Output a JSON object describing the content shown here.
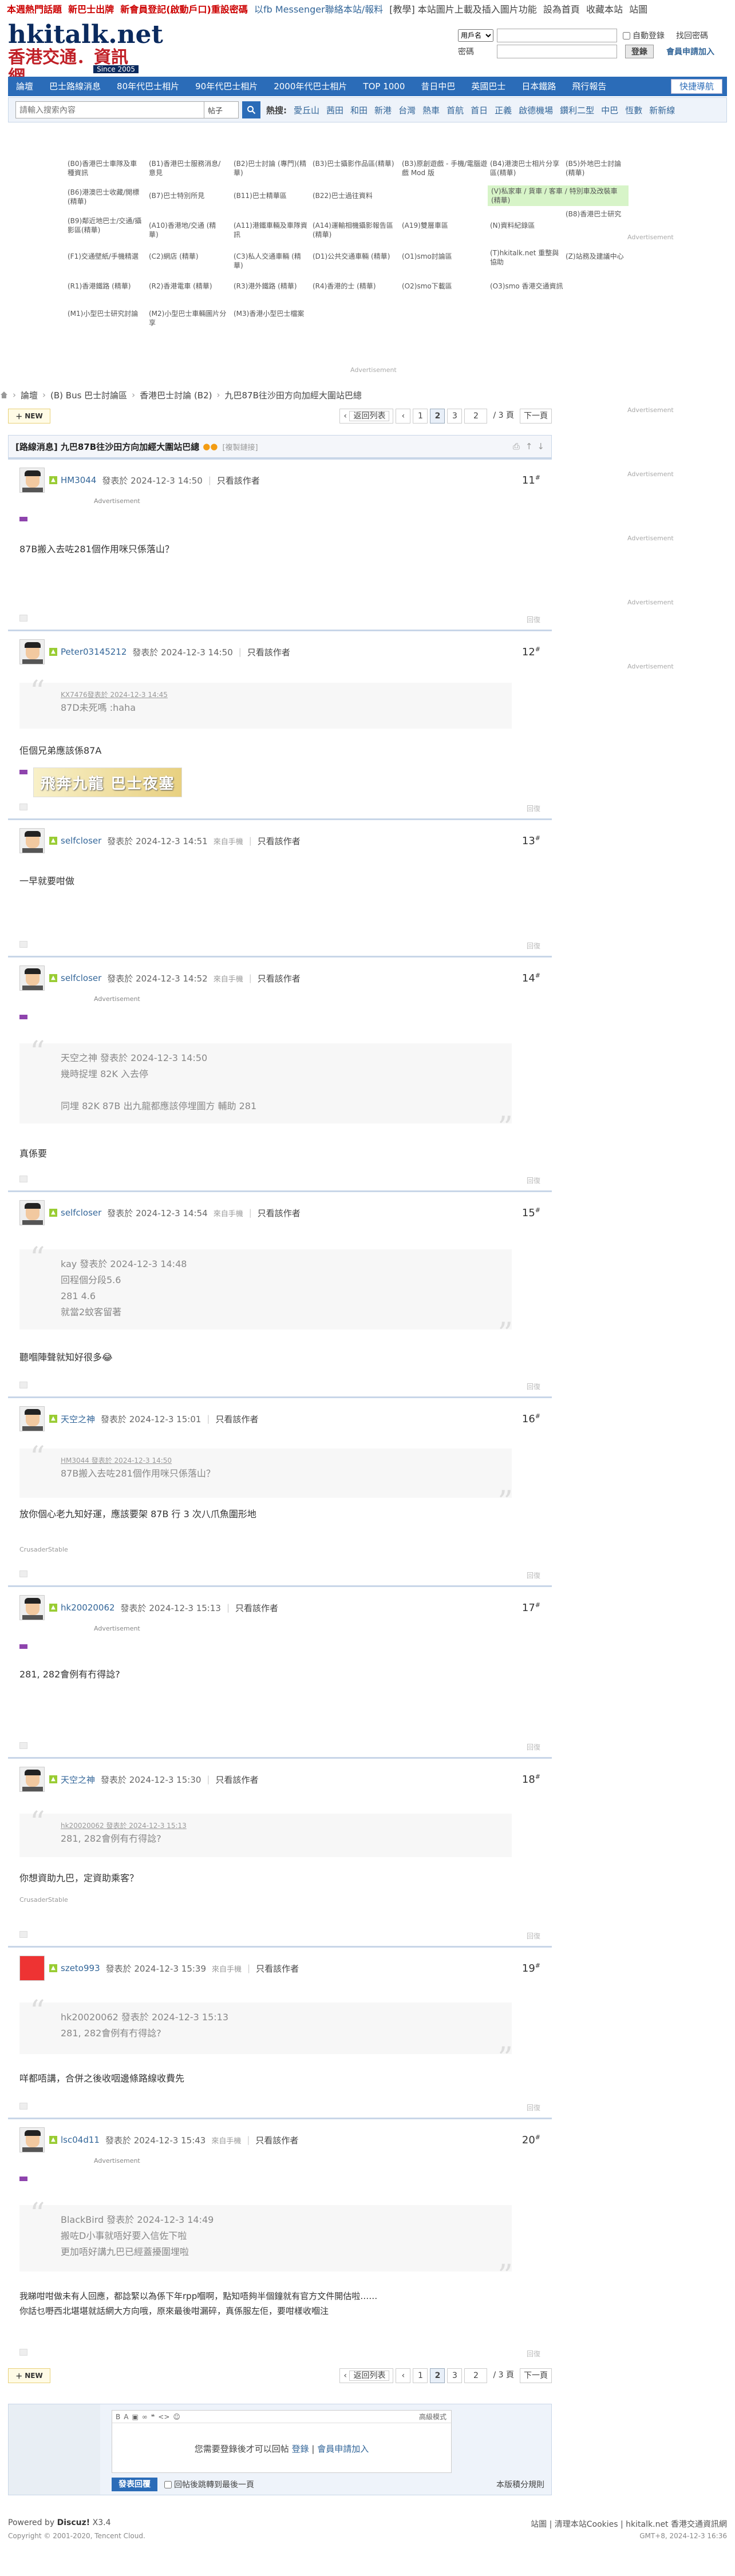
{
  "topnotice": [
    {
      "text": "本週熱門話題",
      "color": "#c00"
    },
    {
      "text": "新巴士出牌",
      "color": "#c00"
    },
    {
      "text": "新會員登記(啟動戶口)重設密碼",
      "color": "#c00"
    },
    {
      "text": "以fb Messenger聯絡本站/報料",
      "color": "#369"
    },
    {
      "text": "[教學] 本站圖片上載及插入圖片功能",
      "color": "#333"
    },
    {
      "text": "設為首頁",
      "color": "#333"
    },
    {
      "text": "收藏本站",
      "color": "#333"
    },
    {
      "text": "站圖",
      "color": "#333"
    }
  ],
  "logo": {
    "line1": "hkitalk.net",
    "line2": "香港交通．資訊網",
    "since": "Since 2005"
  },
  "login": {
    "username_select": "用戶名",
    "password_label": "密碼",
    "auto_login": "自動登錄",
    "find_password": "找回密碼",
    "login_button": "登錄",
    "register": "會員申請加入"
  },
  "nav": {
    "items": [
      "論壇",
      "巴士路線消息",
      "80年代巴士相片",
      "90年代巴士相片",
      "2000年代巴士相片",
      "TOP 1000",
      "昔日中巴",
      "英國巴士",
      "日本鐵路",
      "飛行報告"
    ],
    "quick": "快捷導航"
  },
  "search": {
    "placeholder": "請輸入搜索內容",
    "scope": "帖子",
    "hot_label": "熱搜:",
    "hot": [
      "愛丘山",
      "茜田",
      "和田",
      "新港",
      "台灣",
      "熱車",
      "首航",
      "首日",
      "正義",
      "啟德機場",
      "鑽利二型",
      "中巴",
      "恆數",
      "新新線"
    ]
  },
  "forums": [
    "(B0)香港巴士車隊及車種資訊",
    "(B1)香港巴士服務消息/意見",
    "(B2)巴士討論 (專門)(精華)",
    "(B3)巴士攝影作品區(精華)",
    "(B3)原創遊戲 - 手機/電腦遊戲 Mod 版",
    "(B4)港澳巴士相片分享區(精華)",
    "(B5)外地巴士討論 (精華)",
    "(B6)港澳巴士收藏/開標(精華)",
    "(B7)巴士特別所見",
    "(B11)巴士精華區",
    "(B22)巴士過往資料",
    "(V)私家車 / 貨車 / 客車 / 特別車及改裝車 (精華)",
    "(B8)香港巴士研究",
    "(B9)鄰近地巴士/交通/攝影區(精華)",
    "(A10)香港地/交通 (精華)",
    "(A11)港鐵車輛及車隊資訊",
    "(A14)運輸相機攝影報告區(精華)",
    "(A19)雙層車區",
    "(N)資料紀錄區",
    "(F1)交通壁紙/手機精選",
    "(C2)網店 (精華)",
    "(C3)私人交通車輛 (精華)",
    "(D1)公共交通車輛 (精華)",
    "(O1)smo討論區",
    "(T)hkitalk.net 重整與 協助",
    "(Z)站務及建議中心",
    "(R1)香港鐵路 (精華)",
    "(R2)香港電車 (精華)",
    "(R3)港外鐵路 (精華)",
    "(R4)香港的士 (精華)",
    "(O2)smo下載區",
    "(O3)smo 香港交通資訊",
    "(M1)小型巴士研究討論",
    "(M2)小型巴士車輛圖片分享",
    "(M3)香港小型巴士檔案"
  ],
  "ads": {
    "label": "Advertisement"
  },
  "crumb": [
    "論壇",
    "(B) Bus 巴士討論區",
    "香港巴士討論 (B2)",
    "九巴87B往沙田方向加經大圍站巴總"
  ],
  "pager": {
    "new_label": "NEW",
    "back": "返回列表",
    "pages": [
      "1",
      "2",
      "3"
    ],
    "current": "2",
    "input_val": "2",
    "total": "/ 3 頁",
    "next": "下一頁"
  },
  "thread": {
    "title": "[路線消息] 九巴87B往沙田方向加經大圍站巴總",
    "tag": "[複製鏈接]"
  },
  "posts": [
    {
      "user": "HM3044",
      "time": "發表於 2024-12-3 14:50",
      "only": "只看該作者",
      "floor": "11",
      "body": "87B搬入去咗281個作用咪只係落山？"
    },
    {
      "user": "Peter03145212",
      "time": "發表於 2024-12-3 14:50",
      "only": "只看該作者",
      "floor": "12",
      "quote_small": "KX7476發表於 2024-12-3 14:45",
      "quote": "87D未死嗎 :haha",
      "body": "佢個兄弟應該係87A",
      "sig": "飛奔九龍 巴士夜塞"
    },
    {
      "user": "selfcloser",
      "time": "發表於 2024-12-3 14:51",
      "mobile": "來自手機",
      "only": "只看該作者",
      "floor": "13",
      "body": "一早就要咁做"
    },
    {
      "user": "selfcloser",
      "time": "發表於 2024-12-3 14:52",
      "mobile": "來自手機",
      "only": "只看該作者",
      "floor": "14",
      "quote_lines": [
        "天空之神 發表於 2024-12-3 14:50",
        "幾時捉埋 82K 入去停",
        "",
        "同埋 82K 87B 出九龍都應該停埋圖方 輔助 281"
      ],
      "body": "真係要"
    },
    {
      "user": "selfcloser",
      "time": "發表於 2024-12-3 14:54",
      "mobile": "來自手機",
      "only": "只看該作者",
      "floor": "15",
      "quote_lines": [
        "kay 發表於 2024-12-3 14:48",
        "回程個分段5.6",
        "281 4.6",
        "就當2蚊客留著"
      ],
      "body": "聽嗰陣聲就知好很多😂"
    },
    {
      "user": "天空之神",
      "time": "發表於 2024-12-3 15:01",
      "only": "只看該作者",
      "floor": "16",
      "quote_small": "HM3044 發表於 2024-12-3 14:50",
      "quote": "87B搬入去咗281個作用咪只係落山？",
      "body": "放你個心老九知好運，應該要架 87B 行 3 次八爪魚圍形地",
      "sig": "CrusaderStable"
    },
    {
      "user": "hk20020062",
      "time": "發表於 2024-12-3 15:13",
      "only": "只看該作者",
      "floor": "17",
      "body": "281, 282會例有冇得諗?"
    },
    {
      "user": "天空之神",
      "time": "發表於 2024-12-3 15:30",
      "only": "只看該作者",
      "floor": "18",
      "quote_small": "hk20020062 發表於 2024-12-3 15:13",
      "quote": "281, 282會例有冇得諗?",
      "body": "你想資助九巴，定資助乘客？",
      "sig": "CrusaderStable"
    },
    {
      "user": "szeto993",
      "time": "發表於 2024-12-3 15:39",
      "mobile": "來自手機",
      "only": "只看該作者",
      "floor": "19",
      "quote_lines": [
        "hk20020062 發表於 2024-12-3 15:13",
        "281, 282會例有冇得諗?"
      ],
      "body": "咩都唔講，合併之後收咽邊條路線收費先"
    },
    {
      "user": "lsc04d11",
      "time": "發表於 2024-12-3 15:43",
      "mobile": "來自手機",
      "only": "只看該作者",
      "floor": "20",
      "quote_lines": [
        "BlackBird 發表於 2024-12-3 14:49",
        "搬咗D小事就唔好要入信佐下啦",
        "更加唔好講九巴已經蓋擾圍埋啦"
      ],
      "body_lines": [
        "我睇咁咁做未有人回應，都諗緊以為係下年rpp嗰啊，點知唔夠半個鐘就有官方文件開估啦……",
        "你話乜嘢西北堪堪就話網大方向哦，原來最後咁漏碎，真係服左佢，要咁樣收嗰注"
      ]
    }
  ],
  "post_footer": {
    "rate": "評分",
    "reply": "回復"
  },
  "reply": {
    "advanced": "高級模式",
    "need_login": "您需要登錄後才可以回帖",
    "login_link": "登錄",
    "register_link": "會員申請加入",
    "submit": "發表回覆",
    "jump": "回帖後跳轉到最後一頁",
    "points": "本版積分規則"
  },
  "footer": {
    "powered": "Powered by",
    "discuz": "Discuz!",
    "ver": "X3.4",
    "copy": "Copyright © 2001-2020, Tencent Cloud.",
    "links": "站圖 | 清理本站Cookies | hkitalk.net 香港交通資訊網",
    "gmt": "GMT+8, 2024-12-3 16:36"
  }
}
